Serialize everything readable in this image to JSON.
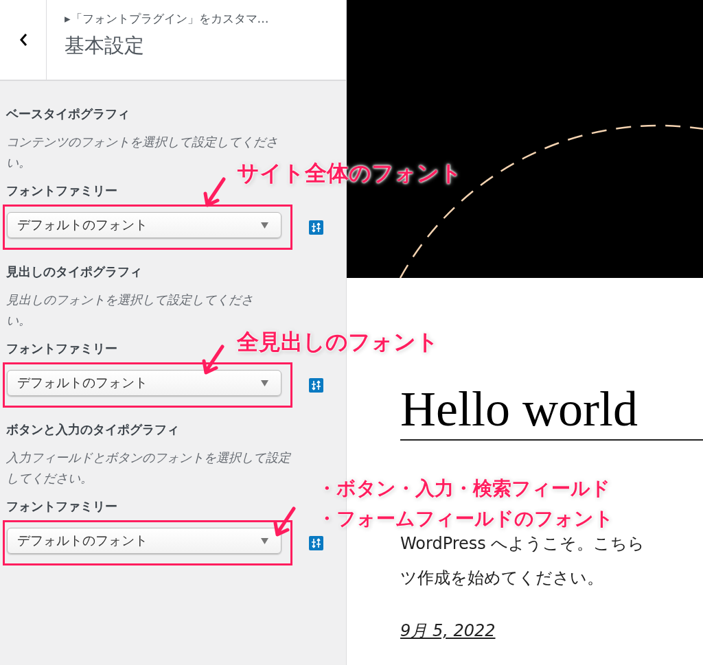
{
  "header": {
    "breadcrumb": "▸「フォントプラグイン」をカスタマ…",
    "title": "基本設定"
  },
  "sections": [
    {
      "title": "ベースタイポグラフィ",
      "description": "コンテンツのフォントを選択して設定してください。",
      "label": "フォントファミリー",
      "value": "デフォルトのフォント",
      "highlighted": true
    },
    {
      "title": "見出しのタイポグラフィ",
      "description": "見出しのフォントを選択して設定してください。",
      "label": "フォントファミリー",
      "value": "デフォルトのフォント",
      "highlighted": true
    },
    {
      "title": "ボタンと入力のタイポグラフィ",
      "description": "入力フィールドとボタンのフォントを選択して設定してください。",
      "label": "フォントファミリー",
      "value": "デフォルトのフォント",
      "highlighted": true
    }
  ],
  "preview": {
    "heading": "Hello world",
    "paragraph_lines": [
      "WordPress へようこそ。こちら",
      "ツ作成を始めてください。"
    ],
    "date": "9月 5, 2022"
  },
  "annotations": [
    {
      "lines": [
        "サイト全体のフォント"
      ]
    },
    {
      "lines": [
        "全見出しのフォント"
      ]
    },
    {
      "lines": [
        "・ボタン・入力・検索フィールド",
        "・フォームフィールドのフォント"
      ]
    }
  ]
}
